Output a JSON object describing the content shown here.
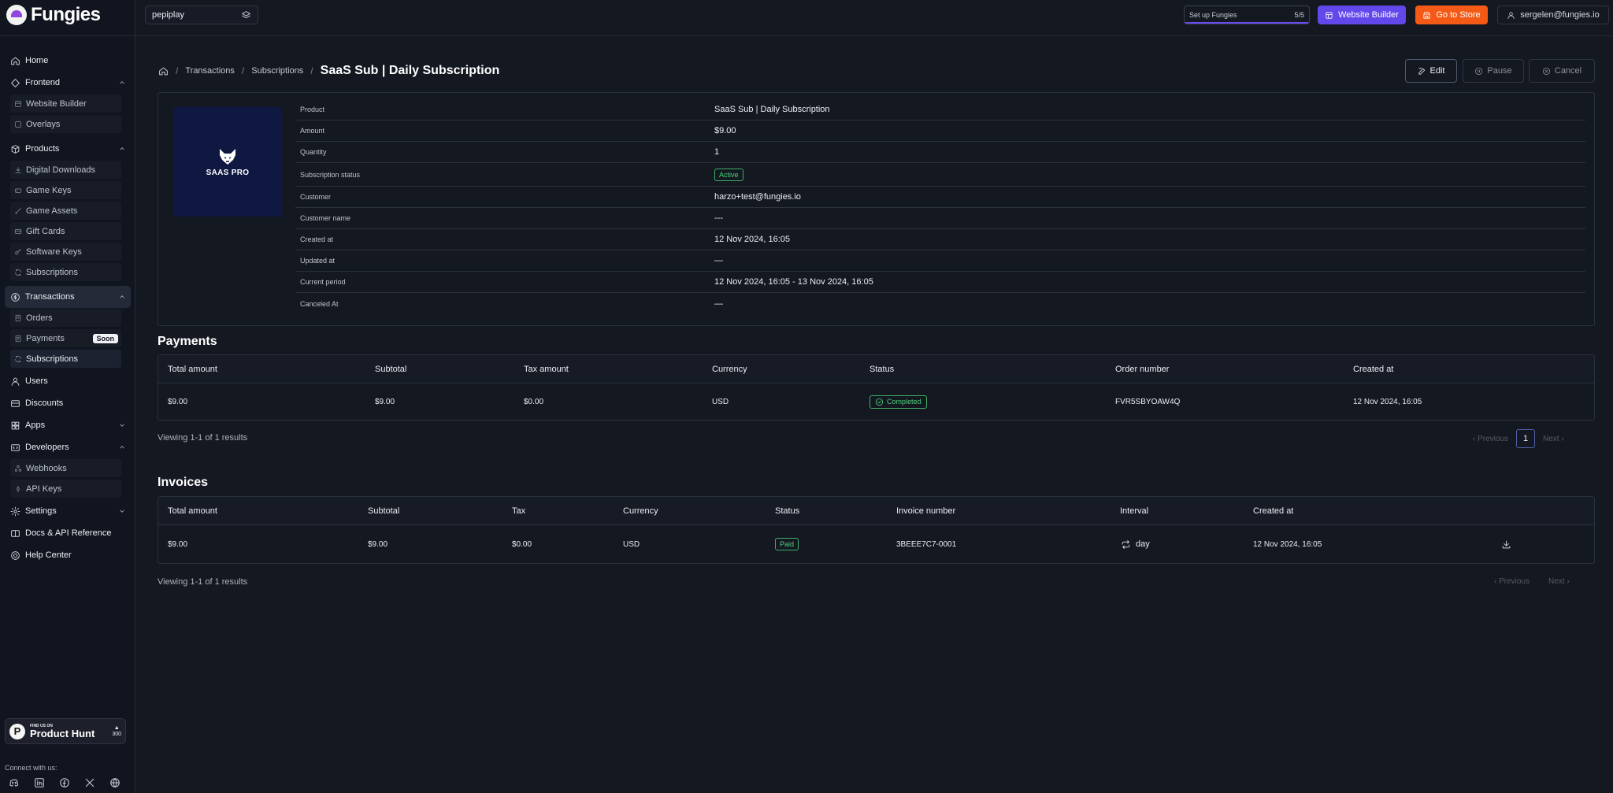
{
  "brand": {
    "name": "Fungies"
  },
  "header": {
    "store": "pepiplay",
    "setup_label": "Set up Fungies",
    "setup_progress": "5/5",
    "setup_fraction": 1.0,
    "website_builder": "Website Builder",
    "go_to_store": "Go to Store",
    "user_email": "sergelen@fungies.io",
    "colors": {
      "website_builder": "#6247ea",
      "go_to_store": "#f45a16"
    }
  },
  "sidebar": {
    "home": "Home",
    "frontend": "Frontend",
    "frontend_items": [
      "Website Builder",
      "Overlays"
    ],
    "products": "Products",
    "products_items": [
      "Digital Downloads",
      "Game Keys",
      "Game Assets",
      "Gift Cards",
      "Software Keys",
      "Subscriptions"
    ],
    "transactions": "Transactions",
    "transactions_items": [
      "Orders",
      "Payments",
      "Subscriptions"
    ],
    "soon": "Soon",
    "users": "Users",
    "discounts": "Discounts",
    "apps": "Apps",
    "developers": "Developers",
    "developers_items": [
      "Webhooks",
      "API Keys"
    ],
    "settings": "Settings",
    "docs": "Docs & API Reference",
    "help": "Help Center",
    "product_hunt_small": "FIND US ON",
    "product_hunt_big": "Product Hunt",
    "product_hunt_votes": "300",
    "connect": "Connect with us:"
  },
  "breadcrumb": {
    "transactions": "Transactions",
    "subscriptions": "Subscriptions",
    "current": "SaaS Sub | Daily Subscription"
  },
  "actions": {
    "edit": "Edit",
    "pause": "Pause",
    "cancel": "Cancel"
  },
  "product_image_text": "SAAS PRO",
  "details": [
    {
      "key": "Product",
      "value": "SaaS Sub | Daily Subscription"
    },
    {
      "key": "Amount",
      "value": "$9.00"
    },
    {
      "key": "Quantity",
      "value": "1"
    },
    {
      "key": "Subscription status",
      "value": "Active"
    },
    {
      "key": "Customer",
      "value": "harzo+test@fungies.io"
    },
    {
      "key": "Customer name",
      "value": "---"
    },
    {
      "key": "Created at",
      "value": "12 Nov 2024, 16:05"
    },
    {
      "key": "Updated at",
      "value": "—"
    },
    {
      "key": "Current period",
      "value": "12 Nov 2024, 16:05 - 13 Nov 2024, 16:05"
    },
    {
      "key": "Canceled At",
      "value": "—"
    }
  ],
  "payments": {
    "title": "Payments",
    "columns": [
      "Total amount",
      "Subtotal",
      "Tax amount",
      "Currency",
      "Status",
      "Order number",
      "Created at"
    ],
    "rows": [
      {
        "total": "$9.00",
        "subtotal": "$9.00",
        "tax": "$0.00",
        "currency": "USD",
        "status": "Completed",
        "order": "FVR5SBYOAW4Q",
        "created": "12 Nov 2024, 16:05"
      }
    ],
    "viewing": "Viewing 1-1 of 1 results",
    "previous": "Previous",
    "next": "Next",
    "page": "1"
  },
  "invoices": {
    "title": "Invoices",
    "columns": [
      "Total amount",
      "Subtotal",
      "Tax",
      "Currency",
      "Status",
      "Invoice number",
      "Interval",
      "Created at"
    ],
    "rows": [
      {
        "total": "$9.00",
        "subtotal": "$9.00",
        "tax": "$0.00",
        "currency": "USD",
        "status": "Paid",
        "invoice": "3BEEE7C7-0001",
        "interval": "day",
        "created": "12 Nov 2024, 16:05"
      }
    ],
    "viewing": "Viewing 1-1 of 1 results",
    "previous": "Previous",
    "next": "Next"
  }
}
